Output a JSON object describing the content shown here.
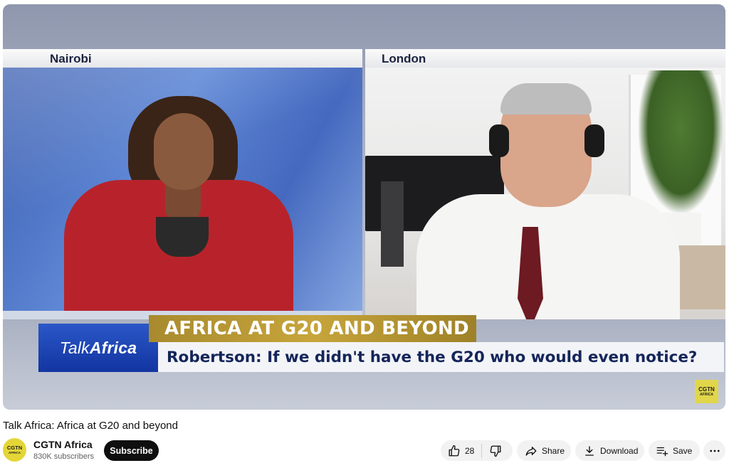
{
  "player": {
    "left_panel_label": "Nairobi",
    "right_panel_label": "London",
    "brand_box": {
      "part1": "Talk",
      "part2": "Africa"
    },
    "headline": "AFRICA AT G20 AND BEYOND",
    "subline": "Robertson: If we didn't have the G20 who would even notice?",
    "watermark": {
      "line1": "CGTN",
      "line2": "AFRICA"
    },
    "colors": {
      "headline_gold": "#c7a53b",
      "subline_navy": "#14255a",
      "brand_blue": "#1235a1"
    }
  },
  "video": {
    "title": "Talk Africa: Africa at G20 and beyond"
  },
  "channel": {
    "avatar": {
      "line1": "CGTN",
      "line2": "AFRICA"
    },
    "name": "CGTN Africa",
    "subscribers": "830K subscribers",
    "subscribe_label": "Subscribe"
  },
  "actions": {
    "likes": "28",
    "share_label": "Share",
    "download_label": "Download",
    "save_label": "Save",
    "icons": [
      "thumbs-up-icon",
      "thumbs-down-icon",
      "share-arrow-icon",
      "download-icon",
      "save-playlist-icon",
      "more-dots-icon"
    ]
  }
}
